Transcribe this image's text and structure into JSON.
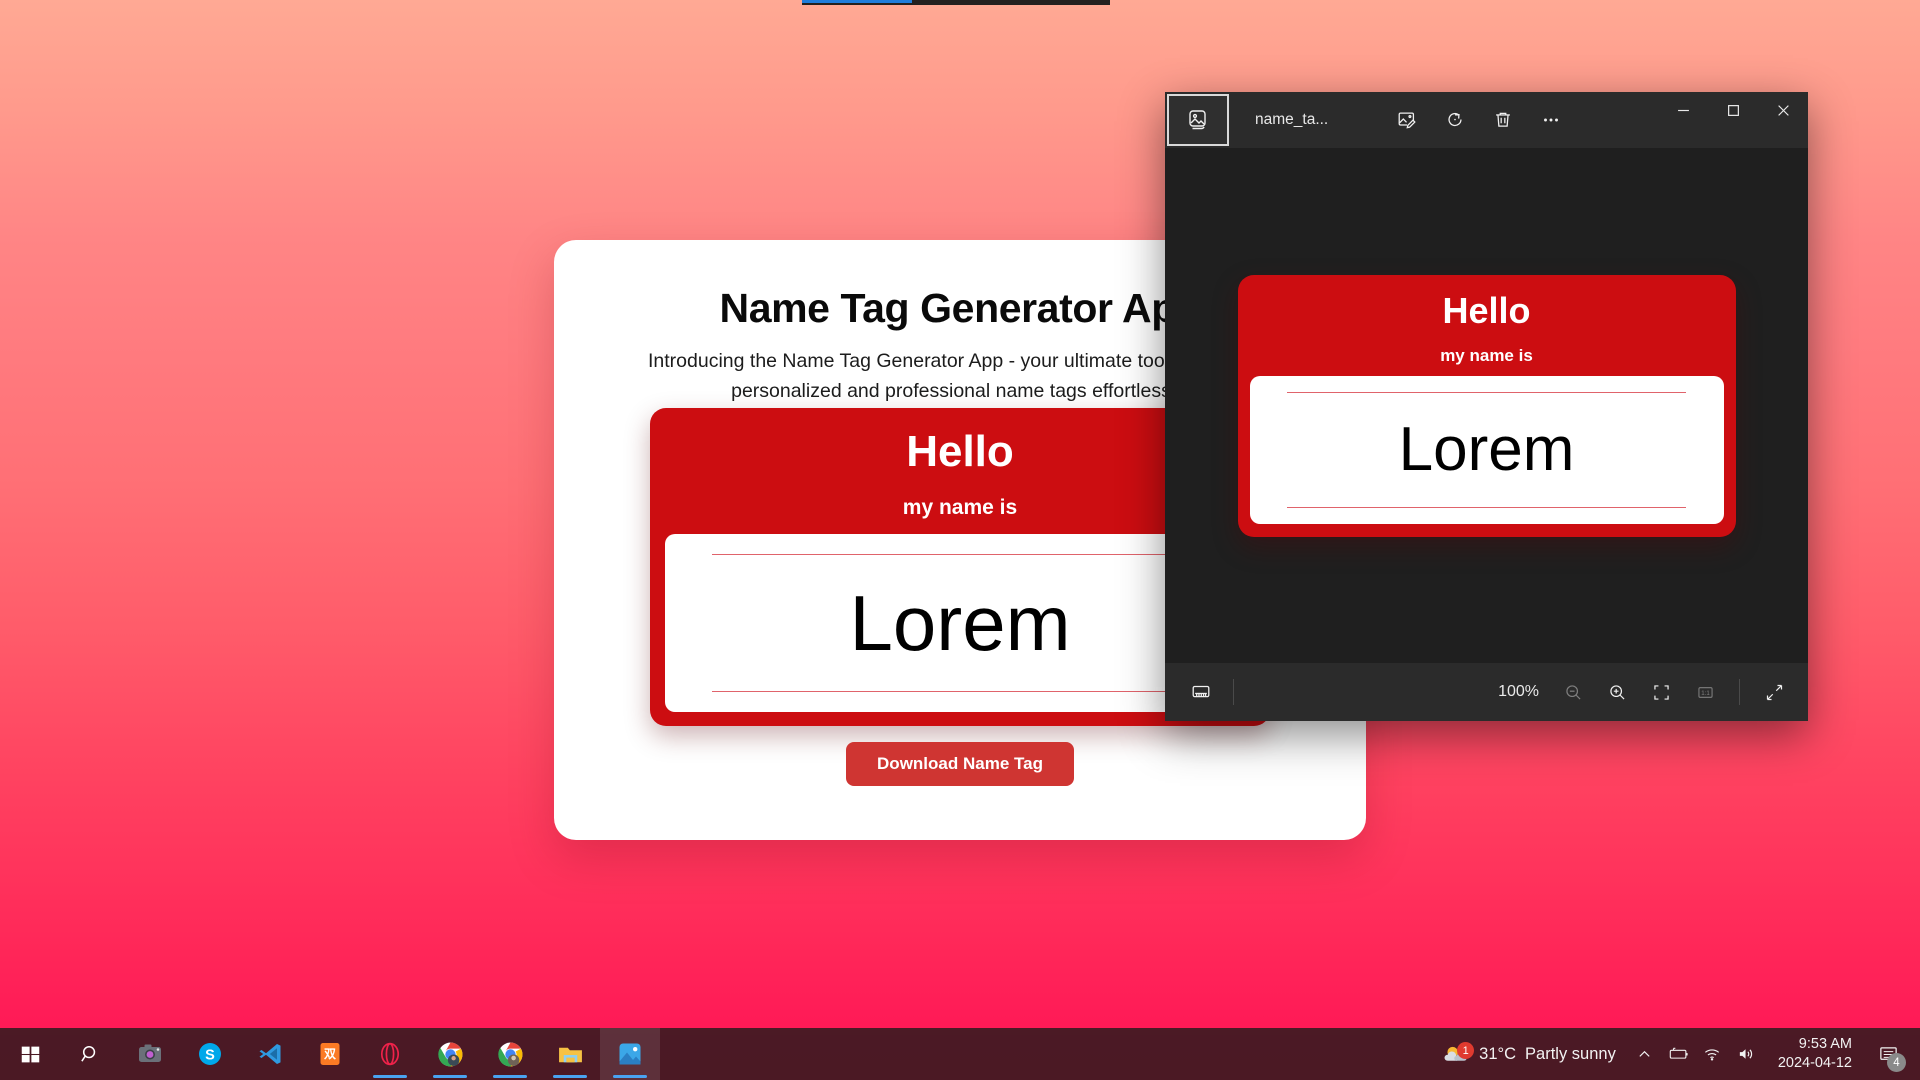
{
  "desktop": {
    "gradient_top": "#ffa994",
    "gradient_bottom": "#ff1155"
  },
  "webpage": {
    "title": "Name Tag Generator App",
    "subtitle": "Introducing the Name Tag Generator App - your ultimate tool for creating personalized and professional name tags effortlessly.",
    "download_label": "Download Name Tag",
    "accent_red": "#cc0d11",
    "button_red": "#cf3532",
    "nametag": {
      "hello": "Hello",
      "my_name_is": "my name is",
      "name": "Lorem"
    }
  },
  "photos_app": {
    "filename": "name_ta...",
    "gallery_icon": "photo-collection-icon",
    "toolbar": [
      {
        "name": "edit-image-button",
        "icon": "image-edit-icon"
      },
      {
        "name": "rotate-button",
        "icon": "rotate-icon"
      },
      {
        "name": "delete-button",
        "icon": "trash-icon"
      },
      {
        "name": "more-options-button",
        "icon": "ellipsis-icon"
      }
    ],
    "window_controls": [
      {
        "name": "minimize-button",
        "icon": "minimize-icon"
      },
      {
        "name": "maximize-button",
        "icon": "maximize-icon"
      },
      {
        "name": "close-button",
        "icon": "close-icon"
      }
    ],
    "bottom_bar": {
      "filmstrip_icon": "filmstrip-icon",
      "zoom_level": "100%",
      "controls": [
        {
          "name": "zoom-out-button",
          "icon": "zoom-out-icon",
          "dimmed": true
        },
        {
          "name": "zoom-in-button",
          "icon": "zoom-in-icon",
          "dimmed": false
        },
        {
          "name": "fit-to-window-button",
          "icon": "fit-to-window-icon",
          "dimmed": false
        },
        {
          "name": "actual-size-button",
          "icon": "one-to-one-icon",
          "dimmed": true
        },
        {
          "name": "fullscreen-button",
          "icon": "expand-arrows-icon",
          "dimmed": false
        }
      ]
    },
    "image": {
      "hello": "Hello",
      "my_name_is": "my name is",
      "name": "Lorem"
    }
  },
  "taskbar": {
    "apps": [
      {
        "name": "start-button",
        "icon": "windows-logo-icon",
        "running": false
      },
      {
        "name": "search-button",
        "icon": "search-icon",
        "running": false
      },
      {
        "name": "camera-button",
        "icon": "camera-icon",
        "running": false
      },
      {
        "name": "skype-button",
        "icon": "skype-icon",
        "running": false
      },
      {
        "name": "vscode-button",
        "icon": "vscode-icon",
        "running": false
      },
      {
        "name": "xampp-button",
        "icon": "xampp-icon",
        "running": false
      },
      {
        "name": "opera-button",
        "icon": "opera-icon",
        "running": true
      },
      {
        "name": "chrome-button-1",
        "icon": "chrome-icon",
        "running": true
      },
      {
        "name": "chrome-button-2",
        "icon": "chrome-icon",
        "running": true
      },
      {
        "name": "file-explorer-button",
        "icon": "folder-icon",
        "running": true
      },
      {
        "name": "photos-button",
        "icon": "photos-icon",
        "running": true,
        "active": true
      }
    ],
    "weather": {
      "temperature": "31°C",
      "condition": "Partly sunny",
      "badge": "1"
    },
    "tray": [
      {
        "name": "show-hidden-icons-button",
        "icon": "chevron-up-icon"
      },
      {
        "name": "battery-button",
        "icon": "battery-icon"
      },
      {
        "name": "network-button",
        "icon": "wifi-icon"
      },
      {
        "name": "volume-button",
        "icon": "speaker-icon"
      }
    ],
    "clock": {
      "time": "9:53 AM",
      "date": "2024-04-12"
    },
    "notifications": {
      "count": "4",
      "icon": "notification-icon"
    }
  }
}
